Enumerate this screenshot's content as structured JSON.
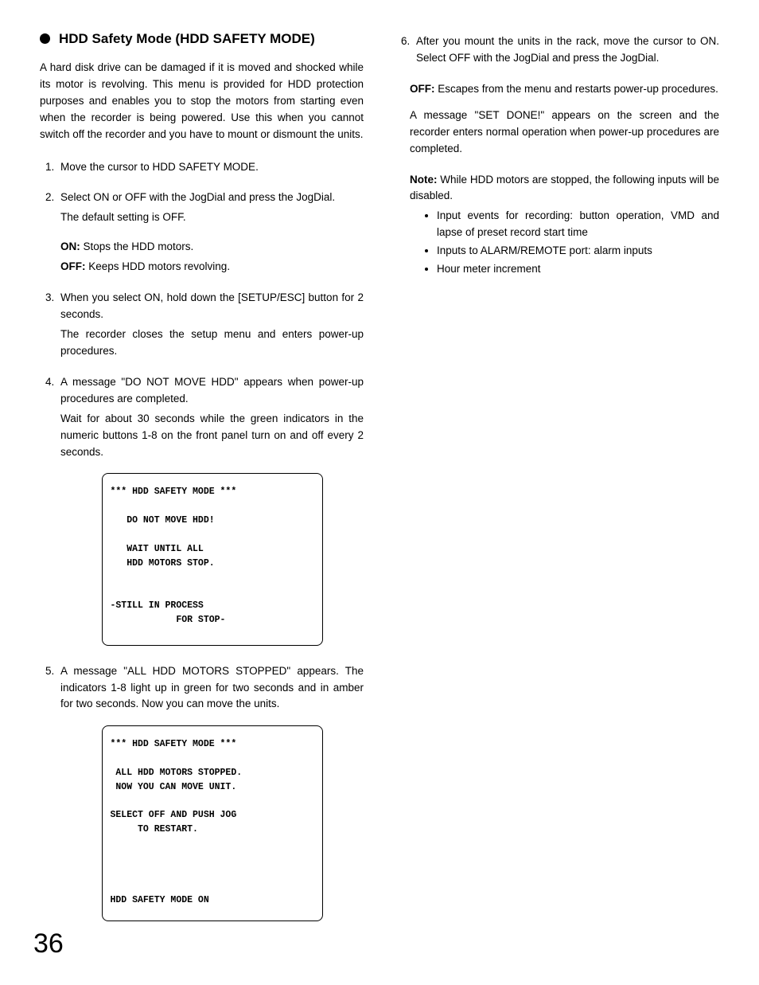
{
  "pageNumber": "36",
  "left": {
    "title": "HDD Safety Mode (HDD SAFETY MODE)",
    "intro": "A hard disk drive can be damaged if it is moved and shocked while its motor is revolving. This menu is provided for HDD protection purposes and enables you to stop the motors from starting even when the recorder is being powered. Use this when you cannot switch off the recorder and you have to mount or dismount the units.",
    "steps": {
      "s1": "Move the cursor to HDD SAFETY MODE.",
      "s2a": "Select ON or OFF with the JogDial and press the JogDial.",
      "s2b": "The default setting is OFF.",
      "s2_on_label": "ON:",
      "s2_on_text": " Stops the HDD motors.",
      "s2_off_label": "OFF:",
      "s2_off_text": " Keeps HDD motors revolving.",
      "s3a": "When you select ON, hold down the [SETUP/ESC] button for 2 seconds.",
      "s3b": "The recorder closes the setup menu and enters power-up procedures.",
      "s4a": "A message \"DO NOT MOVE HDD\" appears when power-up procedures are completed.",
      "s4b": "Wait for about 30 seconds while the green indicators in the numeric buttons 1-8 on the front panel turn on and off every 2 seconds.",
      "s5": "A message \"ALL HDD MOTORS STOPPED\" appears. The indicators 1-8 light up in green for two seconds and in amber for two seconds. Now you can move the units."
    },
    "termbox1": "*** HDD SAFETY MODE ***\n\n   DO NOT MOVE HDD!\n\n   WAIT UNTIL ALL\n   HDD MOTORS STOP.\n\n\n-STILL IN PROCESS\n            FOR STOP-",
    "termbox2": "*** HDD SAFETY MODE ***\n\n ALL HDD MOTORS STOPPED.\n NOW YOU CAN MOVE UNIT.\n\nSELECT OFF AND PUSH JOG\n     TO RESTART.\n\n\n\n\nHDD SAFETY MODE ON"
  },
  "right": {
    "s6": "After you mount the units in the rack, move the cursor to ON. Select OFF with the JogDial and press the JogDial.",
    "off_label": "OFF:",
    "off_text": " Escapes from the menu and restarts power-up procedures.",
    "msg": "A message \"SET DONE!\" appears on the screen and the recorder enters normal operation when power-up procedures are completed.",
    "note_label": "Note:",
    "note_text": " While HDD motors are stopped, the following inputs will be disabled.",
    "bullets": {
      "b1": "Input events for recording: button operation, VMD and lapse of preset record start time",
      "b2": "Inputs to ALARM/REMOTE port: alarm inputs",
      "b3": "Hour meter increment"
    }
  }
}
